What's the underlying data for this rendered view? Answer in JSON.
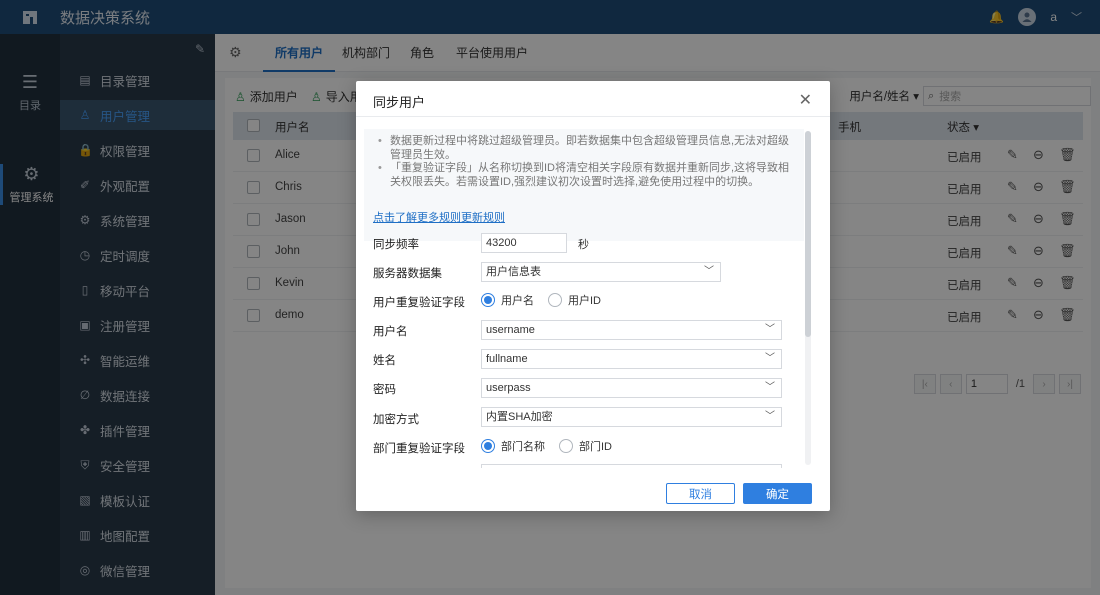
{
  "app": {
    "title": "数据决策系统",
    "user": "a"
  },
  "rail": {
    "items": [
      {
        "label": "目录"
      },
      {
        "label": "管理系统"
      }
    ]
  },
  "sidebar": {
    "items": [
      {
        "label": "目录管理"
      },
      {
        "label": "用户管理"
      },
      {
        "label": "权限管理"
      },
      {
        "label": "外观配置"
      },
      {
        "label": "系统管理"
      },
      {
        "label": "定时调度"
      },
      {
        "label": "移动平台"
      },
      {
        "label": "注册管理"
      },
      {
        "label": "智能运维"
      },
      {
        "label": "数据连接"
      },
      {
        "label": "插件管理"
      },
      {
        "label": "安全管理"
      },
      {
        "label": "模板认证"
      },
      {
        "label": "地图配置"
      },
      {
        "label": "微信管理"
      }
    ]
  },
  "tabs": [
    {
      "label": "所有用户"
    },
    {
      "label": "机构部门"
    },
    {
      "label": "角色"
    },
    {
      "label": "平台使用用户"
    }
  ],
  "toolbar": {
    "add_user": "添加用户",
    "import_user": "导入用户"
  },
  "search": {
    "type_label": "用户名/姓名",
    "placeholder": "搜索"
  },
  "table": {
    "headers": {
      "username": "用户名",
      "phone": "手机",
      "status": "状态"
    },
    "rows": [
      {
        "username": "Alice",
        "status": "已启用"
      },
      {
        "username": "Chris",
        "status": "已启用"
      },
      {
        "username": "Jason",
        "status": "已启用"
      },
      {
        "username": "John",
        "status": "已启用"
      },
      {
        "username": "Kevin",
        "status": "已启用"
      },
      {
        "username": "demo",
        "status": "已启用"
      }
    ]
  },
  "pager": {
    "current": "1",
    "total": "/1"
  },
  "modal": {
    "title": "同步用户",
    "notices": [
      "数据更新过程中将跳过超级管理员。即若数据集中包含超级管理员信息,无法对超级管理员生效。",
      "「重复验证字段」从名称切换到ID将清空相关字段原有数据并重新同步,这将导致相关权限丢失。若需设置ID,强烈建议初次设置时选择,避免使用过程中的切换。"
    ],
    "link": "点击了解更多规则更新规则",
    "fields": {
      "freq_label": "同步频率",
      "freq_value": "43200",
      "freq_unit": "秒",
      "dataset_label": "服务器数据集",
      "dataset_value": "用户信息表",
      "user_dup_label": "用户重复验证字段",
      "user_dup_opt1": "用户名",
      "user_dup_opt2": "用户ID",
      "username_label": "用户名",
      "username_value": "username",
      "fullname_label": "姓名",
      "fullname_value": "fullname",
      "password_label": "密码",
      "password_value": "userpass",
      "encrypt_label": "加密方式",
      "encrypt_value": "内置SHA加密",
      "dept_dup_label": "部门重复验证字段",
      "dept_dup_opt1": "部门名称",
      "dept_dup_opt2": "部门ID"
    },
    "cancel": "取消",
    "ok": "确定"
  }
}
